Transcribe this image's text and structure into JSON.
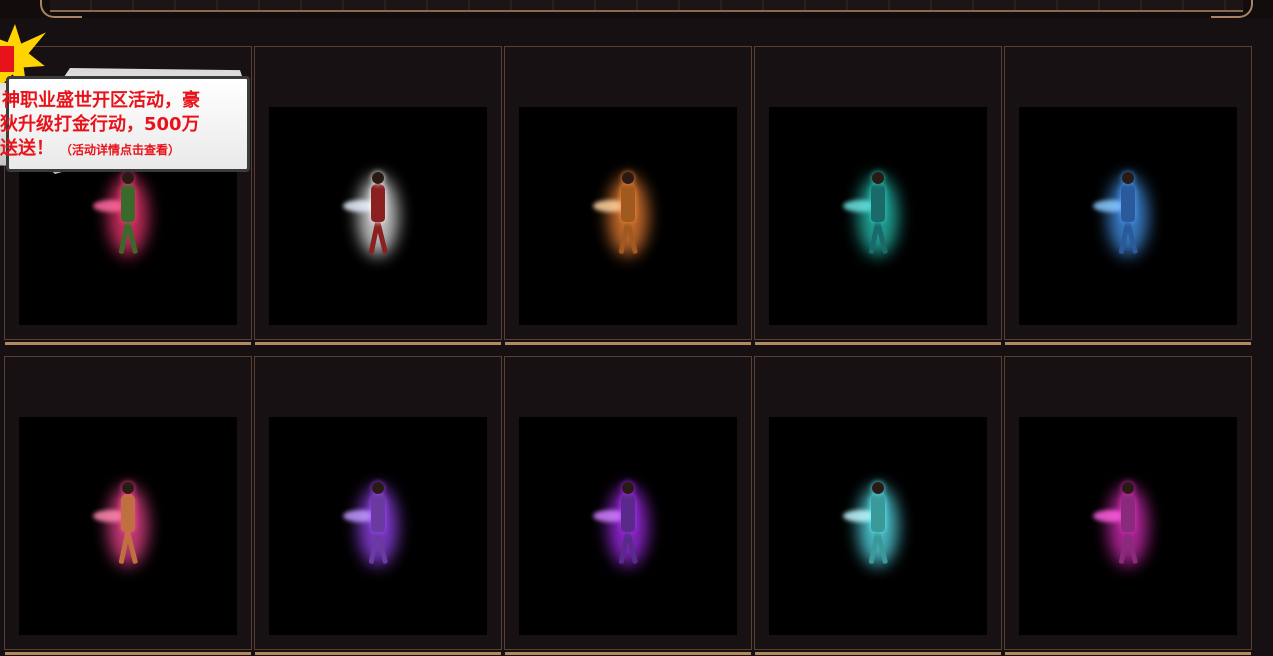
{
  "promo": {
    "line1": "神职业盛世开区活动，豪",
    "line2": "狄升级打金行动，500万",
    "line3_main": "送送！",
    "line3_note": "（活动详情点击查看）",
    "colors": {
      "text": "#e8131a",
      "burst": "#ffd400",
      "plate": "#eeeeee"
    }
  },
  "gallery": {
    "rows": [
      {
        "items": [
          {
            "icon": "character-preview",
            "glow": "#ff3b7a",
            "body": "#3a6a2a",
            "weapon": "#ff6aa0"
          },
          {
            "icon": "character-preview",
            "glow": "#ffffff",
            "body": "#8a2020",
            "weapon": "#e8f0ff"
          },
          {
            "icon": "character-preview",
            "glow": "#ff8a3a",
            "body": "#a05a20",
            "weapon": "#ffd2a0"
          },
          {
            "icon": "character-preview",
            "glow": "#2ad0c0",
            "body": "#1a6a6a",
            "weapon": "#6ae0e0"
          },
          {
            "icon": "character-preview",
            "glow": "#4aa0ff",
            "body": "#2a5a9a",
            "weapon": "#8ac8ff"
          }
        ]
      },
      {
        "items": [
          {
            "icon": "character-preview",
            "glow": "#ff4a9a",
            "body": "#c07040",
            "weapon": "#ff8ab0"
          },
          {
            "icon": "character-preview",
            "glow": "#a04aff",
            "body": "#6a3aa0",
            "weapon": "#c09aff"
          },
          {
            "icon": "character-preview",
            "glow": "#b030ff",
            "body": "#5a2a8a",
            "weapon": "#d080ff"
          },
          {
            "icon": "character-preview",
            "glow": "#60f0ff",
            "body": "#3a9a9a",
            "weapon": "#c0f8ff"
          },
          {
            "icon": "character-preview",
            "glow": "#e030c0",
            "body": "#8a2a7a",
            "weapon": "#ff60e0"
          }
        ]
      }
    ]
  }
}
